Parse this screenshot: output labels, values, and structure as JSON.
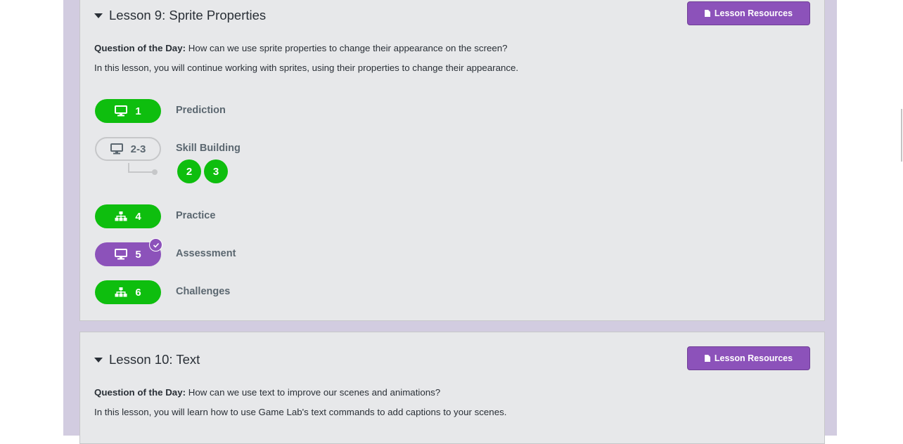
{
  "lessons": [
    {
      "title": "Lesson 9: Sprite Properties",
      "resources_label": "Lesson Resources",
      "question_label": "Question of the Day:",
      "question_text": " How can we use sprite properties to change their appearance on the screen?",
      "description": "In this lesson, you will continue working with sprites, using their properties to change their appearance.",
      "levels": [
        {
          "number": "1",
          "label": "Prediction",
          "icon": "desktop-icon",
          "status": "completed"
        },
        {
          "number": "2-3",
          "label": "Skill Building",
          "icon": "desktop-icon",
          "status": "not-started",
          "sublevels": [
            "2",
            "3"
          ]
        },
        {
          "number": "4",
          "label": "Practice",
          "icon": "sitemap-icon",
          "status": "completed"
        },
        {
          "number": "5",
          "label": "Assessment",
          "icon": "desktop-icon",
          "status": "submitted"
        },
        {
          "number": "6",
          "label": "Challenges",
          "icon": "sitemap-icon",
          "status": "completed"
        }
      ]
    },
    {
      "title": "Lesson 10: Text",
      "resources_label": "Lesson Resources",
      "question_label": "Question of the Day:",
      "question_text": " How can we use text to improve our scenes and animations?",
      "description": "In this lesson, you will learn how to use Game Lab's text commands to add captions to your scenes."
    }
  ],
  "colors": {
    "completed": "#0ebe0e",
    "submitted": "#8c52ba",
    "resources_button": "#8c52ba",
    "lesson_bg": "#e7e8ea",
    "outer_bg": "#d2cce0"
  }
}
